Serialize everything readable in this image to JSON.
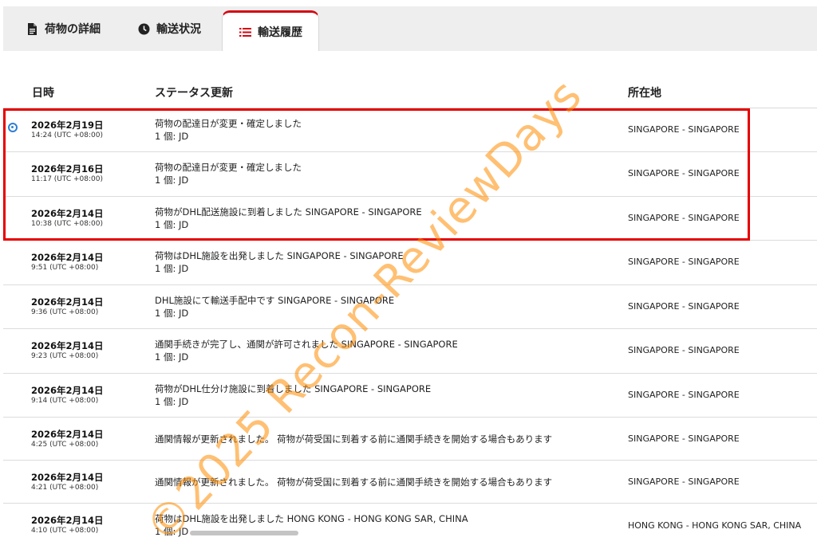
{
  "tabs": [
    {
      "label": "荷物の詳細",
      "icon": "document-icon"
    },
    {
      "label": "輸送状況",
      "icon": "clock-icon"
    },
    {
      "label": "輸送履歴",
      "icon": "list-icon",
      "active": true
    }
  ],
  "headers": {
    "datetime": "日時",
    "status": "ステータス更新",
    "location": "所在地"
  },
  "rows": [
    {
      "date": "2026年2月19日",
      "time": "14:24 (UTC +08:00)",
      "status": "荷物の配達日が変更・確定しました",
      "detail": "1 個: JD",
      "location": "SINGAPORE - SINGAPORE"
    },
    {
      "date": "2026年2月16日",
      "time": "11:17 (UTC +08:00)",
      "status": "荷物の配達日が変更・確定しました",
      "detail": "1 個: JD",
      "location": "SINGAPORE - SINGAPORE"
    },
    {
      "date": "2026年2月14日",
      "time": "10:38 (UTC +08:00)",
      "status": "荷物がDHL配送施設に到着しました SINGAPORE - SINGAPORE",
      "detail": "1 個: JD",
      "location": "SINGAPORE - SINGAPORE"
    },
    {
      "date": "2026年2月14日",
      "time": "9:51 (UTC +08:00)",
      "status": "荷物はDHL施設を出発しました SINGAPORE - SINGAPORE",
      "detail": "1 個: JD",
      "location": "SINGAPORE - SINGAPORE"
    },
    {
      "date": "2026年2月14日",
      "time": "9:36 (UTC +08:00)",
      "status": "DHL施設にて輸送手配中です SINGAPORE - SINGAPORE",
      "detail": "1 個: JD",
      "location": "SINGAPORE - SINGAPORE"
    },
    {
      "date": "2026年2月14日",
      "time": "9:23 (UTC +08:00)",
      "status": "通関手続きが完了し、通関が許可されました SINGAPORE - SINGAPORE",
      "detail": "1 個: JD",
      "location": "SINGAPORE - SINGAPORE"
    },
    {
      "date": "2026年2月14日",
      "time": "9:14 (UTC +08:00)",
      "status": "荷物がDHL仕分け施設に到着しました SINGAPORE - SINGAPORE",
      "detail": "1 個: JD",
      "location": "SINGAPORE - SINGAPORE"
    },
    {
      "date": "2026年2月14日",
      "time": "4:25 (UTC +08:00)",
      "status": "通関情報が更新されました。 荷物が荷受国に到着する前に通関手続きを開始する場合もあります",
      "detail": "",
      "location": "SINGAPORE - SINGAPORE"
    },
    {
      "date": "2026年2月14日",
      "time": "4:21 (UTC +08:00)",
      "status": "通関情報が更新されました。 荷物が荷受国に到着する前に通関手続きを開始する場合もあります",
      "detail": "",
      "location": "SINGAPORE - SINGAPORE"
    },
    {
      "date": "2026年2月14日",
      "time": "4:10 (UTC +08:00)",
      "status": "荷物はDHL施設を出発しました HONG KONG - HONG KONG SAR, CHINA",
      "detail": "1 個: JD",
      "location": "HONG KONG - HONG KONG SAR, CHINA"
    }
  ],
  "watermark": "©2025 Recon-ReviewDays",
  "colors": {
    "accent": "#d40511",
    "highlight": "#e60000",
    "current_dot": "#2d7fd3",
    "watermark": "#ff8c00"
  }
}
